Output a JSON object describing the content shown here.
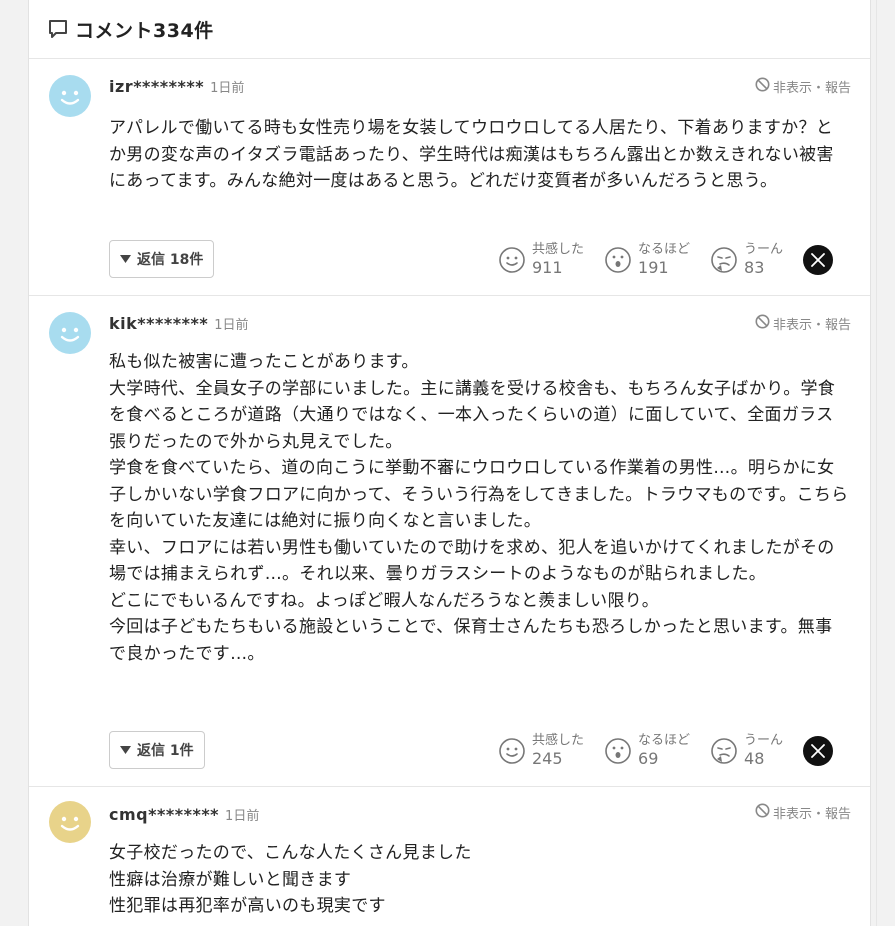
{
  "header": {
    "title": "コメント334件"
  },
  "comments": [
    {
      "user": "izr********",
      "time": "1日前",
      "hide_report": "非表示・報告",
      "avatar_color": "#a8dcef",
      "text": "アパレルで働いてる時も女性売り場を女装してウロウロしてる人居たり、下着ありますか？とか男の変な声のイタズラ電話あったり、学生時代は痴漢はもちろん露出とか数えきれない被害にあってます。みんな絶対一度はあると思う。どれだけ変質者が多いんだろうと思う。",
      "reply_label": "返信 18件",
      "reactions": [
        {
          "icon": "smile-icon",
          "label": "共感した",
          "count": "911"
        },
        {
          "icon": "surprised-icon",
          "label": "なるほど",
          "count": "191"
        },
        {
          "icon": "thinking-icon",
          "label": "うーん",
          "count": "83"
        }
      ]
    },
    {
      "user": "kik********",
      "time": "1日前",
      "hide_report": "非表示・報告",
      "avatar_color": "#a8dcef",
      "text": "私も似た被害に遭ったことがあります。\n大学時代、全員女子の学部にいました。主に講義を受ける校舎も、もちろん女子ばかり。学食を食べるところが道路（大通りではなく、一本入ったくらいの道）に面していて、全面ガラス張りだったので外から丸見えでした。\n学食を食べていたら、道の向こうに挙動不審にウロウロしている作業着の男性…。明らかに女子しかいない学食フロアに向かって、そういう行為をしてきました。トラウマものです。こちらを向いていた友達には絶対に振り向くなと言いました。\n幸い、フロアには若い男性も働いていたので助けを求め、犯人を追いかけてくれましたがその場では捕まえられず…。それ以来、曇りガラスシートのようなものが貼られました。\nどこにでもいるんですね。よっぽど暇人なんだろうなと羨ましい限り。\n今回は子どもたちもいる施設ということで、保育士さんたちも恐ろしかったと思います。無事で良かったです…。",
      "reply_label": "返信 1件",
      "reactions": [
        {
          "icon": "smile-icon",
          "label": "共感した",
          "count": "245"
        },
        {
          "icon": "surprised-icon",
          "label": "なるほど",
          "count": "69"
        },
        {
          "icon": "thinking-icon",
          "label": "うーん",
          "count": "48"
        }
      ]
    },
    {
      "user": "cmq********",
      "time": "1日前",
      "hide_report": "非表示・報告",
      "avatar_color": "#e8d38a",
      "text": "女子校だったので、こんな人たくさん見ました\n性癖は治療が難しいと聞きます\n性犯罪は再犯率が高いのも現実です"
    }
  ],
  "share": {
    "icon": "x-logo-icon"
  }
}
